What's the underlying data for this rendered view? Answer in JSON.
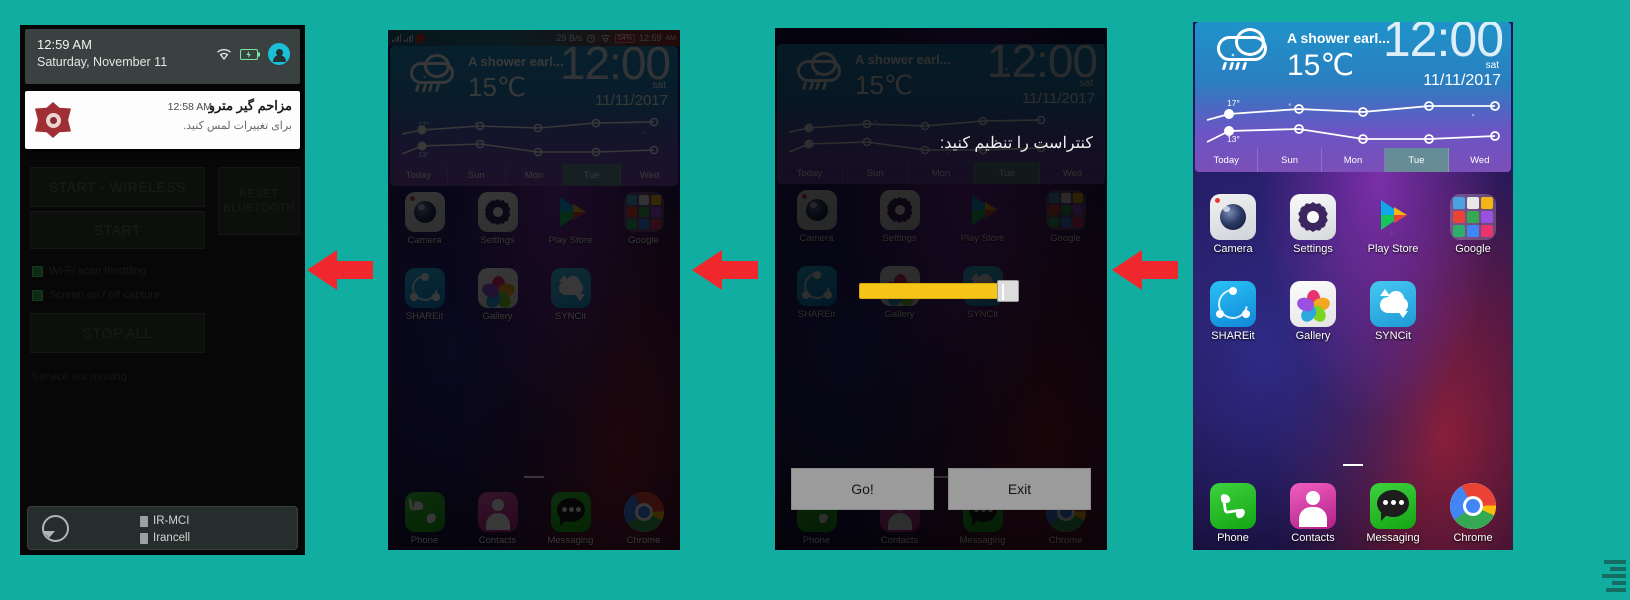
{
  "background_color": "#11ada0",
  "arrow_color": "#f0282d",
  "arrows": [
    {
      "name": "arrow-panel2-to-panel1",
      "direction": "left"
    },
    {
      "name": "arrow-panel3-to-panel2",
      "direction": "left"
    },
    {
      "name": "arrow-panel4-to-panel3",
      "direction": "left"
    }
  ],
  "panel1": {
    "name": "notification-shade-screen",
    "statusbar": {
      "time": "12:59 AM",
      "date": "Saturday, November 11",
      "icons": [
        "wifi-icon",
        "battery-icon",
        "account-avatar-icon"
      ]
    },
    "notification": {
      "app_icon": "metro-jammer-icon",
      "time": "12:58 AM",
      "title": "مزاحم گیر مترو",
      "subtitle": "برای تغییرات لمس کنید."
    },
    "background_app": {
      "buttons": [
        {
          "label": "START - WIRELESS"
        },
        {
          "label": "RESET BLUETOOTH"
        },
        {
          "label": "START"
        },
        {
          "label": "STOP ALL"
        }
      ],
      "checkboxes": [
        {
          "label": "Wi-Fi scan throttling"
        },
        {
          "label": "Screen on / off capture"
        }
      ],
      "note": "Service not running"
    },
    "footer": {
      "refresh_icon": "rotate-refresh-icon",
      "carriers": [
        {
          "sim_icon": "sim-card-icon",
          "label": "IR-MCI"
        },
        {
          "sim_icon": "sim-card-icon",
          "label": "Irancell"
        }
      ]
    }
  },
  "homescreen": {
    "statusbar": {
      "network_speed": "29 B/s",
      "alarm_icon": "alarm-clock-icon",
      "wifi_icon": "wifi-icon",
      "battery_label": "54%",
      "time": "12:59",
      "meridiem": "AM",
      "signal_icon": "signal-bars-icon",
      "notif_icon": "app-notification-icon"
    },
    "weather": {
      "icon": "rain-cloud-icon",
      "description": "A shower earl...",
      "temperature": "15℃",
      "clock": "12:00",
      "day_of_week": "sat",
      "date": "11/11/2017",
      "high": "17°",
      "low": "13°",
      "days": [
        "Today",
        "Sun",
        "Mon",
        "Tue",
        "Wed"
      ],
      "highlighted_day": "Tue"
    },
    "apps": [
      [
        {
          "label": "Camera",
          "icon": "camera-icon"
        },
        {
          "label": "Settings",
          "icon": "settings-gear-icon"
        },
        {
          "label": "Play Store",
          "icon": "play-store-icon"
        },
        {
          "label": "Google",
          "icon": "google-folder-icon"
        }
      ],
      [
        {
          "label": "SHAREit",
          "icon": "shareit-icon"
        },
        {
          "label": "Gallery",
          "icon": "gallery-icon"
        },
        {
          "label": "SYNCit",
          "icon": "syncit-icon"
        },
        {
          "label": "",
          "icon": ""
        }
      ]
    ],
    "dock": [
      {
        "label": "Phone",
        "icon": "phone-icon"
      },
      {
        "label": "Contacts",
        "icon": "contacts-icon"
      },
      {
        "label": "Messaging",
        "icon": "messaging-icon"
      },
      {
        "label": "Chrome",
        "icon": "chrome-icon"
      }
    ]
  },
  "panel3": {
    "name": "contrast-adjust-dialog-screen",
    "prompt": "کنتراست را تنظیم کنید:",
    "slider": {
      "name": "contrast-slider",
      "fill_color": "#f5c518",
      "value_percent": 88
    },
    "buttons": [
      {
        "label": "Go!",
        "name": "go-button"
      },
      {
        "label": "Exit",
        "name": "exit-button"
      }
    ]
  }
}
